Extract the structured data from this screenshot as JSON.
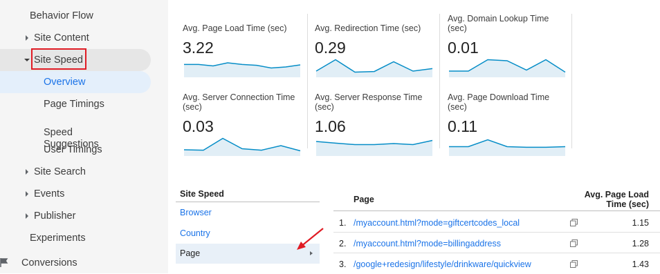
{
  "sidebar": {
    "items": [
      {
        "label": "Behavior Flow"
      },
      {
        "label": "Site Content"
      },
      {
        "label": "Site Speed"
      },
      {
        "label": "Overview"
      },
      {
        "label": "Page Timings"
      },
      {
        "label": "Speed\nSuggestions"
      },
      {
        "label": "User Timings"
      },
      {
        "label": "Site Search"
      },
      {
        "label": "Events"
      },
      {
        "label": "Publisher"
      },
      {
        "label": "Experiments"
      },
      {
        "label": "Conversions"
      }
    ],
    "highlight_color": "#e01b24",
    "selected_bg": "#e4effb"
  },
  "metrics": [
    {
      "title": "Avg. Page Load Time (sec)",
      "value": "3.22",
      "spark": [
        0.62,
        0.62,
        0.55,
        0.7,
        0.62,
        0.58,
        0.45,
        0.5,
        0.6
      ]
    },
    {
      "title": "Avg. Redirection Time (sec)",
      "value": "0.29",
      "spark": [
        0.3,
        0.85,
        0.25,
        0.28,
        0.75,
        0.3,
        0.42
      ]
    },
    {
      "title": "Avg. Domain Lookup Time (sec)",
      "value": "0.01",
      "spark": [
        0.3,
        0.3,
        0.85,
        0.8,
        0.35,
        0.85,
        0.25
      ]
    },
    {
      "title": "Avg. Server Connection Time (sec)",
      "value": "0.03",
      "spark": [
        0.3,
        0.28,
        0.85,
        0.35,
        0.28,
        0.5,
        0.25
      ]
    },
    {
      "title": "Avg. Server Response Time (sec)",
      "value": "1.06",
      "spark": [
        0.7,
        0.62,
        0.55,
        0.55,
        0.6,
        0.55,
        0.75
      ]
    },
    {
      "title": "Avg. Page Download Time (sec)",
      "value": "0.11",
      "spark": [
        0.45,
        0.45,
        0.78,
        0.45,
        0.42,
        0.42,
        0.45
      ]
    }
  ],
  "spark_color": "#058dc7",
  "spark_fill": "#e1eef6",
  "dimension_panel": {
    "header": "Site Speed",
    "links": [
      "Browser",
      "Country"
    ],
    "selected": "Page"
  },
  "table": {
    "col_page": "Page",
    "col_metric": "Avg. Page Load Time (sec)",
    "rows": [
      {
        "idx": "1.",
        "page": "/myaccount.html?mode=giftcertcodes_local",
        "value": "1.15"
      },
      {
        "idx": "2.",
        "page": "/myaccount.html?mode=billingaddress",
        "value": "1.28"
      },
      {
        "idx": "3.",
        "page": "/google+redesign/lifestyle/drinkware/quickview",
        "value": "1.43"
      }
    ]
  }
}
